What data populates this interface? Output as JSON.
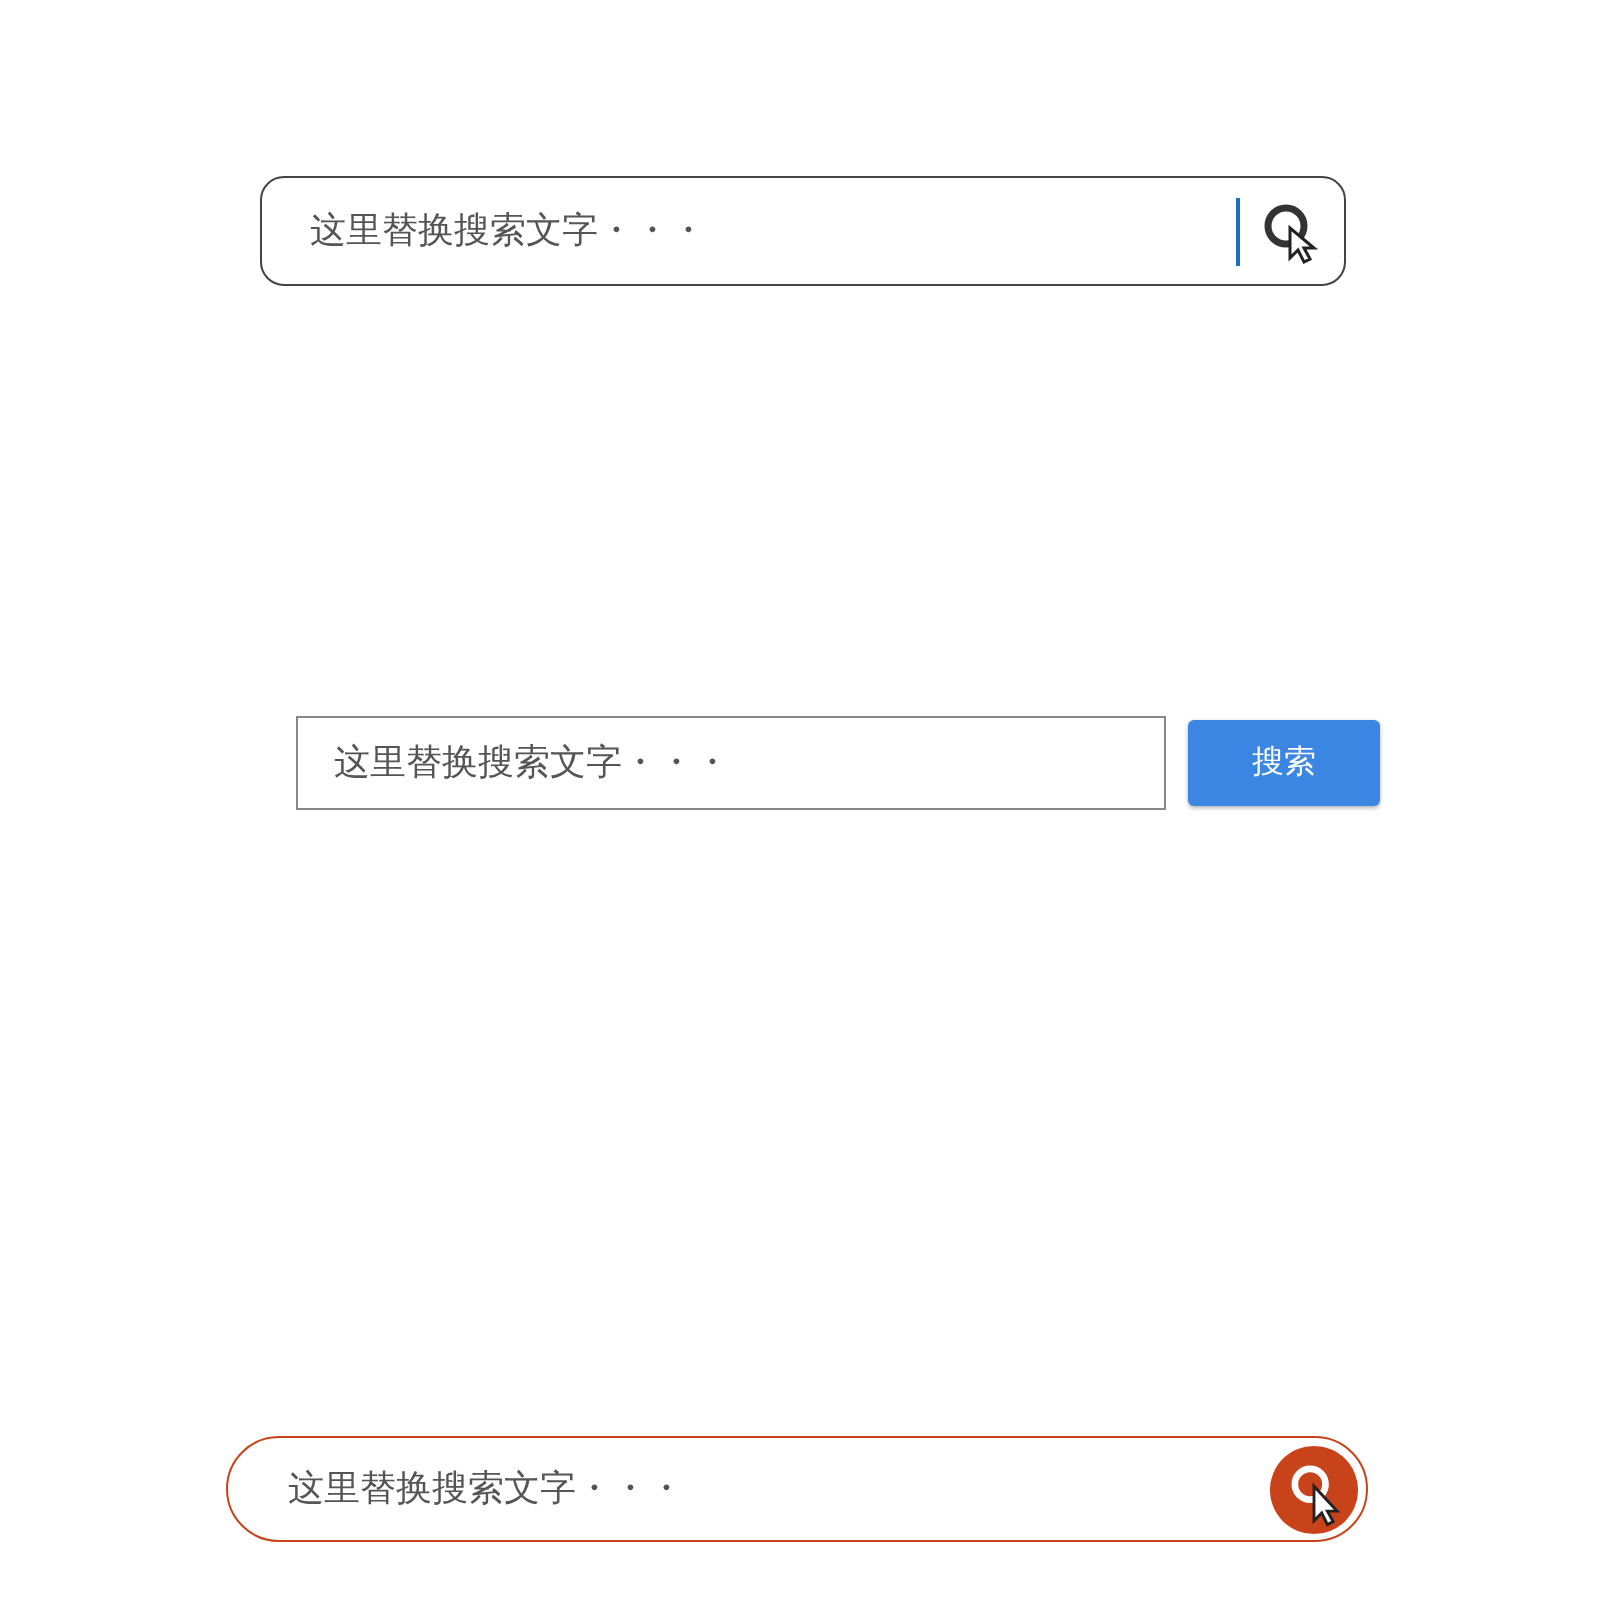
{
  "search_bars": [
    {
      "kind": "rounded-icon",
      "placeholder": "这里替换搜索文字・・・"
    },
    {
      "kind": "square-button",
      "placeholder": "这里替换搜索文字・・・",
      "button": "搜索"
    },
    {
      "kind": "pill-icon",
      "placeholder": "这里替换搜索文字・・・"
    }
  ]
}
